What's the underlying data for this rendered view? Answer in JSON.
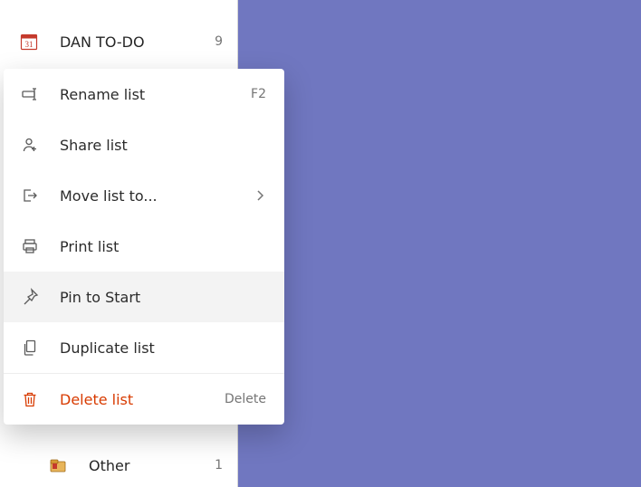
{
  "sidebar": {
    "lists": [
      {
        "label": "DAN TO-DO",
        "count": "9",
        "icon": "calendar-31-icon"
      },
      {
        "label": "Other",
        "count": "1",
        "icon": "folder-emoji-icon"
      }
    ]
  },
  "context_menu": {
    "items": [
      {
        "label": "Rename list",
        "shortcut": "F2",
        "icon": "rename-icon",
        "hover": false
      },
      {
        "label": "Share list",
        "shortcut": "",
        "icon": "share-person-icon",
        "hover": false
      },
      {
        "label": "Move list to...",
        "shortcut": "",
        "icon": "move-to-icon",
        "chevron": true,
        "hover": false
      },
      {
        "label": "Print list",
        "shortcut": "",
        "icon": "print-icon",
        "hover": false
      },
      {
        "label": "Pin to Start",
        "shortcut": "",
        "icon": "pin-icon",
        "hover": true
      },
      {
        "label": "Duplicate list",
        "shortcut": "",
        "icon": "duplicate-icon",
        "hover": false
      },
      {
        "label": "Delete list",
        "shortcut": "Delete",
        "icon": "trash-icon",
        "destructive": true,
        "hover": false
      }
    ],
    "separator_before_index": 6
  },
  "colors": {
    "main_bg": "#7077c0",
    "destructive": "#d83b01"
  }
}
